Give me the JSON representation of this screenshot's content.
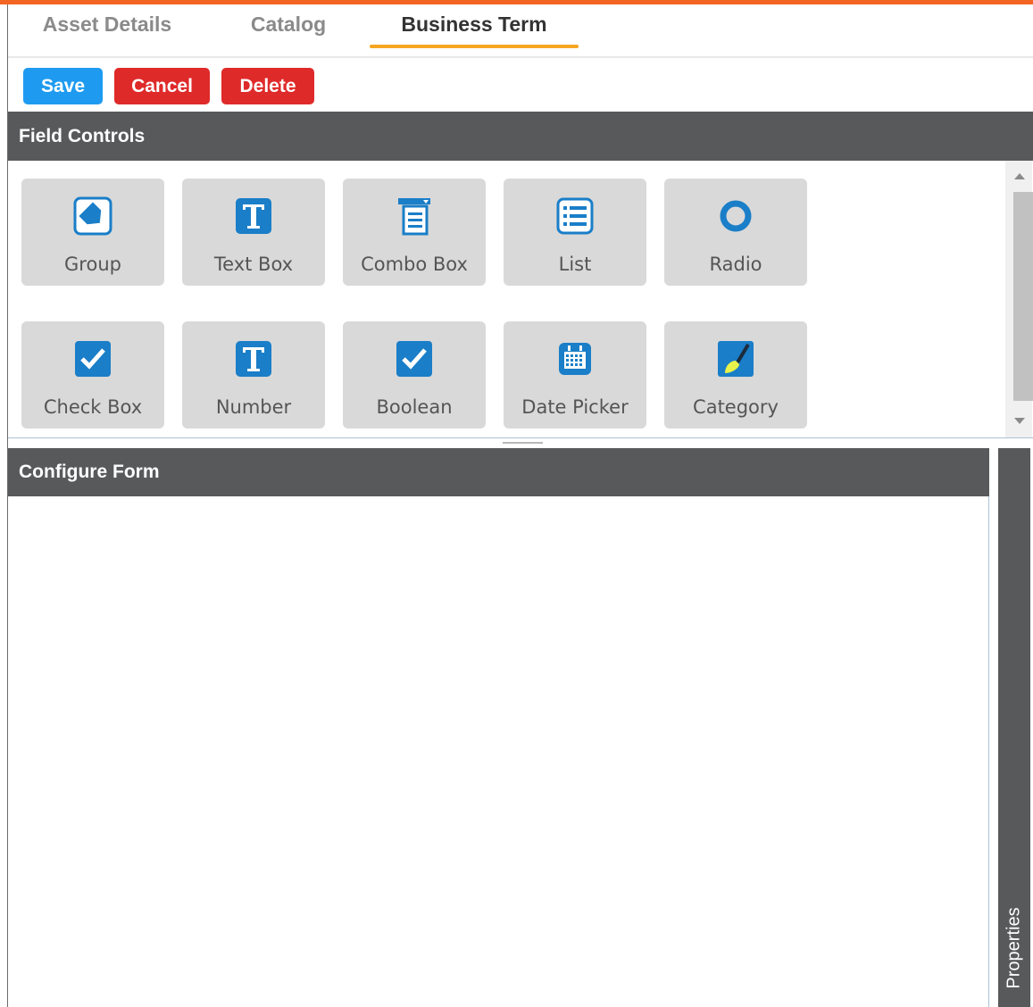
{
  "tabs": [
    {
      "label": "Asset Details"
    },
    {
      "label": "Catalog"
    },
    {
      "label": "Business Term",
      "active": true
    }
  ],
  "toolbar": {
    "save_label": "Save",
    "cancel_label": "Cancel",
    "delete_label": "Delete"
  },
  "field_controls": {
    "title": "Field Controls",
    "items": [
      {
        "label": "Group",
        "icon": "tag-icon"
      },
      {
        "label": "Text Box",
        "icon": "text-t-icon"
      },
      {
        "label": "Combo Box",
        "icon": "combo-box-icon"
      },
      {
        "label": "List",
        "icon": "list-icon"
      },
      {
        "label": "Radio",
        "icon": "radio-icon"
      },
      {
        "label": "Check Box",
        "icon": "checkbox-icon"
      },
      {
        "label": "Number",
        "icon": "text-t-icon"
      },
      {
        "label": "Boolean",
        "icon": "checkbox-icon"
      },
      {
        "label": "Date Picker",
        "icon": "calendar-icon"
      },
      {
        "label": "Category",
        "icon": "brush-icon"
      }
    ]
  },
  "configure_form": {
    "title": "Configure Form"
  },
  "properties": {
    "label": "Properties"
  },
  "colors": {
    "accent": "#f26522",
    "tab_underline": "#f5a623",
    "primary": "#1e9bf0",
    "danger": "#df2a2a",
    "header": "#58595b",
    "icon_blue": "#1a7ec8"
  }
}
